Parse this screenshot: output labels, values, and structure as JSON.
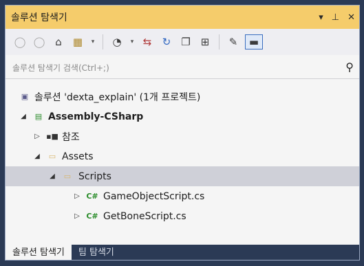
{
  "panel": {
    "title": "솔루션 탐색기",
    "controls": {
      "dropdown": "▾",
      "pin": "⊥",
      "close": "✕"
    }
  },
  "toolbar": {
    "buttons": [
      {
        "icon": "back-icon",
        "glyph": "◯"
      },
      {
        "icon": "forward-icon",
        "glyph": "◯"
      },
      {
        "icon": "home-icon",
        "glyph": "⌂"
      },
      {
        "icon": "switch-views-icon",
        "glyph": "▦"
      },
      {
        "icon": "dropdown-arrow-icon",
        "glyph": "▾"
      },
      {
        "icon": "pending-changes-icon",
        "glyph": "◔"
      },
      {
        "icon": "dropdown-arrow-icon",
        "glyph": "▾"
      },
      {
        "icon": "sync-icon",
        "glyph": "⇆"
      },
      {
        "icon": "refresh-icon",
        "glyph": "↻"
      },
      {
        "icon": "collapse-all-icon",
        "glyph": "❐"
      },
      {
        "icon": "show-all-files-icon",
        "glyph": "⊞"
      },
      {
        "icon": "properties-wrench-icon",
        "glyph": "✎"
      },
      {
        "icon": "preview-icon",
        "glyph": "▬"
      }
    ]
  },
  "search": {
    "placeholder": "솔루션 탐색기 검색(Ctrl+;)",
    "icon_glyph": "⚲"
  },
  "tree": [
    {
      "label": "솔루션 'dexta_explain' (1개 프로젝트)",
      "arrow": "",
      "icon_glyph": "▣"
    },
    {
      "label": "Assembly-CSharp",
      "arrow": "◢",
      "icon_glyph": "▤"
    },
    {
      "label": "참조",
      "arrow": "▷",
      "icon_glyph": "▪■"
    },
    {
      "label": "Assets",
      "arrow": "◢",
      "icon_glyph": "▭"
    },
    {
      "label": "Scripts",
      "arrow": "◢",
      "icon_glyph": "▭"
    },
    {
      "label": "GameObjectScript.cs",
      "arrow": "▷",
      "icon_glyph": "C#"
    },
    {
      "label": "GetBoneScript.cs",
      "arrow": "▷",
      "icon_glyph": "C#"
    }
  ],
  "tabs": [
    {
      "label": "솔루션 탐색기"
    },
    {
      "label": "팀 탐색기"
    }
  ],
  "colors": {
    "accent": "#f5cc6b",
    "tab_bar": "#2b3a55",
    "selection": "#cfd0d8",
    "csharp": "#2a8c2a",
    "folder": "#d8b56a"
  }
}
